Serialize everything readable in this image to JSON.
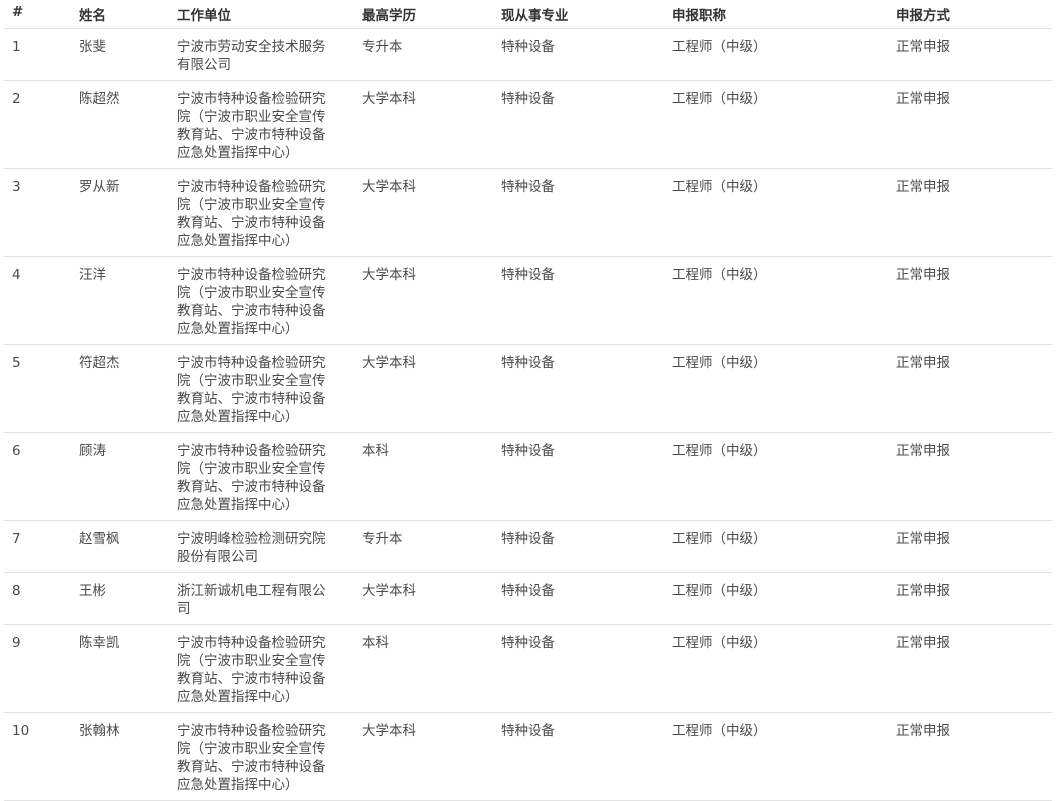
{
  "table": {
    "headers": [
      "#",
      "姓名",
      "工作单位",
      "最高学历",
      "现从事专业",
      "申报职称",
      "申报方式"
    ],
    "rows": [
      {
        "no": "1",
        "name": "张斐",
        "unit": [
          "宁波市劳动安全技术服务",
          "有限公司"
        ],
        "education": "专升本",
        "specialty": "特种设备",
        "title": "工程师（中级）",
        "method": "正常申报"
      },
      {
        "no": "2",
        "name": "陈超然",
        "unit": [
          "宁波市特种设备检验研究",
          "院（宁波市职业安全宣传",
          "教育站、宁波市特种设备",
          "应急处置指挥中心）"
        ],
        "education": "大学本科",
        "specialty": "特种设备",
        "title": "工程师（中级）",
        "method": "正常申报"
      },
      {
        "no": "3",
        "name": "罗从新",
        "unit": [
          "宁波市特种设备检验研究",
          "院（宁波市职业安全宣传",
          "教育站、宁波市特种设备",
          "应急处置指挥中心）"
        ],
        "education": "大学本科",
        "specialty": "特种设备",
        "title": "工程师（中级）",
        "method": "正常申报"
      },
      {
        "no": "4",
        "name": "汪洋",
        "unit": [
          "宁波市特种设备检验研究",
          "院（宁波市职业安全宣传",
          "教育站、宁波市特种设备",
          "应急处置指挥中心）"
        ],
        "education": "大学本科",
        "specialty": "特种设备",
        "title": "工程师（中级）",
        "method": "正常申报"
      },
      {
        "no": "5",
        "name": "符超杰",
        "unit": [
          "宁波市特种设备检验研究",
          "院（宁波市职业安全宣传",
          "教育站、宁波市特种设备",
          "应急处置指挥中心）"
        ],
        "education": "大学本科",
        "specialty": "特种设备",
        "title": "工程师（中级）",
        "method": "正常申报"
      },
      {
        "no": "6",
        "name": "顾涛",
        "unit": [
          "宁波市特种设备检验研究",
          "院（宁波市职业安全宣传",
          "教育站、宁波市特种设备",
          "应急处置指挥中心）"
        ],
        "education": "本科",
        "specialty": "特种设备",
        "title": "工程师（中级）",
        "method": "正常申报"
      },
      {
        "no": "7",
        "name": "赵雪枫",
        "unit": [
          "宁波明峰检验检测研究院",
          "股份有限公司"
        ],
        "education": "专升本",
        "specialty": "特种设备",
        "title": "工程师（中级）",
        "method": "正常申报"
      },
      {
        "no": "8",
        "name": "王彬",
        "unit": [
          "浙江新诚机电工程有限公",
          "司"
        ],
        "education": "大学本科",
        "specialty": "特种设备",
        "title": "工程师（中级）",
        "method": "正常申报"
      },
      {
        "no": "9",
        "name": "陈幸凯",
        "unit": [
          "宁波市特种设备检验研究",
          "院（宁波市职业安全宣传",
          "教育站、宁波市特种设备",
          "应急处置指挥中心）"
        ],
        "education": "本科",
        "specialty": "特种设备",
        "title": "工程师（中级）",
        "method": "正常申报"
      },
      {
        "no": "10",
        "name": "张翰林",
        "unit": [
          "宁波市特种设备检验研究",
          "院（宁波市职业安全宣传",
          "教育站、宁波市特种设备",
          "应急处置指挥中心）"
        ],
        "education": "大学本科",
        "specialty": "特种设备",
        "title": "工程师（中级）",
        "method": "正常申报"
      }
    ]
  }
}
